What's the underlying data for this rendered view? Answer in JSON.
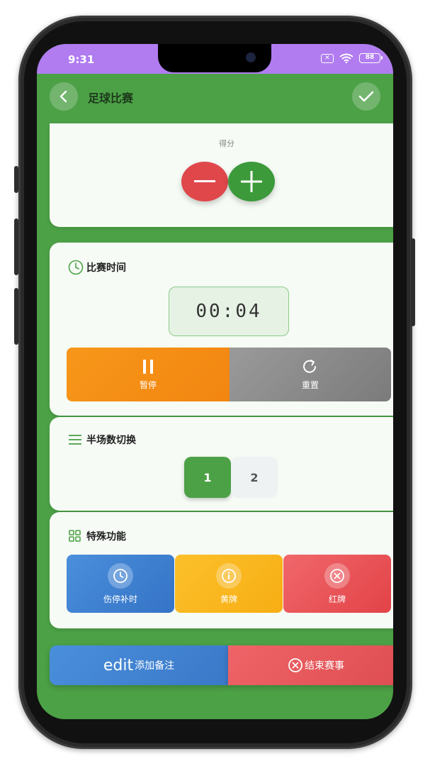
{
  "status_bar": {
    "time": "9:31",
    "battery": "88"
  },
  "header": {
    "title": "足球比赛"
  },
  "score_card": {
    "label": "得分"
  },
  "timer_card": {
    "title": "比赛时间",
    "time_display": "00:04",
    "pause_label": "暂停",
    "reset_label": "重置"
  },
  "half_card": {
    "title": "半场数切换",
    "options": [
      "1",
      "2"
    ],
    "selected": "1"
  },
  "special_card": {
    "title": "特殊功能",
    "buttons": [
      {
        "label": "伤停补时",
        "icon": "clock-icon"
      },
      {
        "label": "黄牌",
        "icon": "info-icon"
      },
      {
        "label": "红牌",
        "icon": "close-circle-icon"
      }
    ]
  },
  "bottom": {
    "note_prefix": "edit",
    "note_label": "添加备注",
    "end_label": "结束赛事"
  },
  "colors": {
    "primary_green": "#4ca146",
    "status_purple": "#b07cf0",
    "pause_orange": "#f7971a",
    "reset_gray": "#8c8c8c",
    "blue": "#3a78c8",
    "yellow": "#f7ae14",
    "red": "#e24347"
  }
}
